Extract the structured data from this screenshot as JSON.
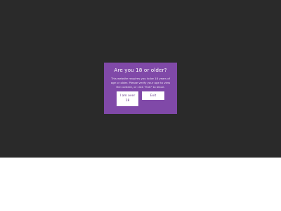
{
  "age_gate": {
    "title": "Are you 18 or older?",
    "message": "This website requires you to be 18 years of age or older. Please verify your age to view the content, or click \"Exit\" to leave.",
    "confirm_label": "I am over 18",
    "exit_label": "Exit"
  },
  "colors": {
    "overlay": "#2a2a2a",
    "modal_background": "#8049a8",
    "button_background": "#ffffff",
    "button_text": "#6a3b8f"
  }
}
